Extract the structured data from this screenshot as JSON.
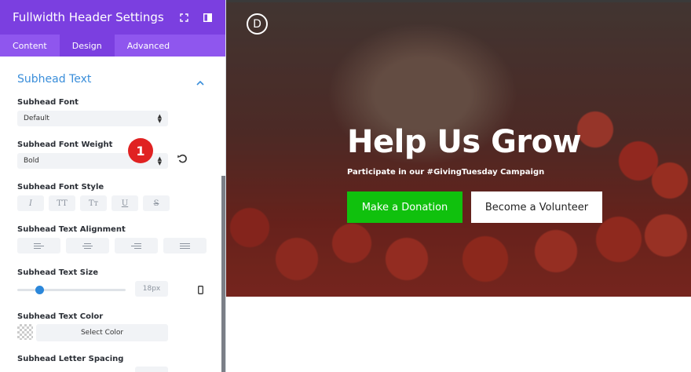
{
  "panel": {
    "title": "Fullwidth Header Settings",
    "tabs": [
      {
        "label": "Content"
      },
      {
        "label": "Design"
      },
      {
        "label": "Advanced"
      }
    ],
    "section_title": "Subhead Text",
    "font_label": "Subhead Font",
    "font_value": "Default",
    "weight_label": "Subhead Font Weight",
    "weight_value": "Bold",
    "style_label": "Subhead Font Style",
    "style_buttons": [
      "I",
      "TT",
      "Tт",
      "U",
      "S"
    ],
    "align_label": "Subhead Text Alignment",
    "size_label": "Subhead Text Size",
    "size_value": "18px",
    "size_fraction": 0.18,
    "color_label": "Subhead Text Color",
    "color_button": "Select Color",
    "spacing_label": "Subhead Letter Spacing",
    "badge": "1"
  },
  "preview": {
    "logo_letter": "D",
    "title": "Help Us Grow",
    "subtitle": "Participate in our #GivingTuesday Campaign",
    "donate_label": "Make a Donation",
    "volunteer_label": "Become a Volunteer"
  },
  "colors": {
    "header": "#7b3fe0",
    "tabs": "#8f56ee",
    "accent": "#3a8eda",
    "donate": "#10c10d",
    "badge": "#e02222"
  }
}
